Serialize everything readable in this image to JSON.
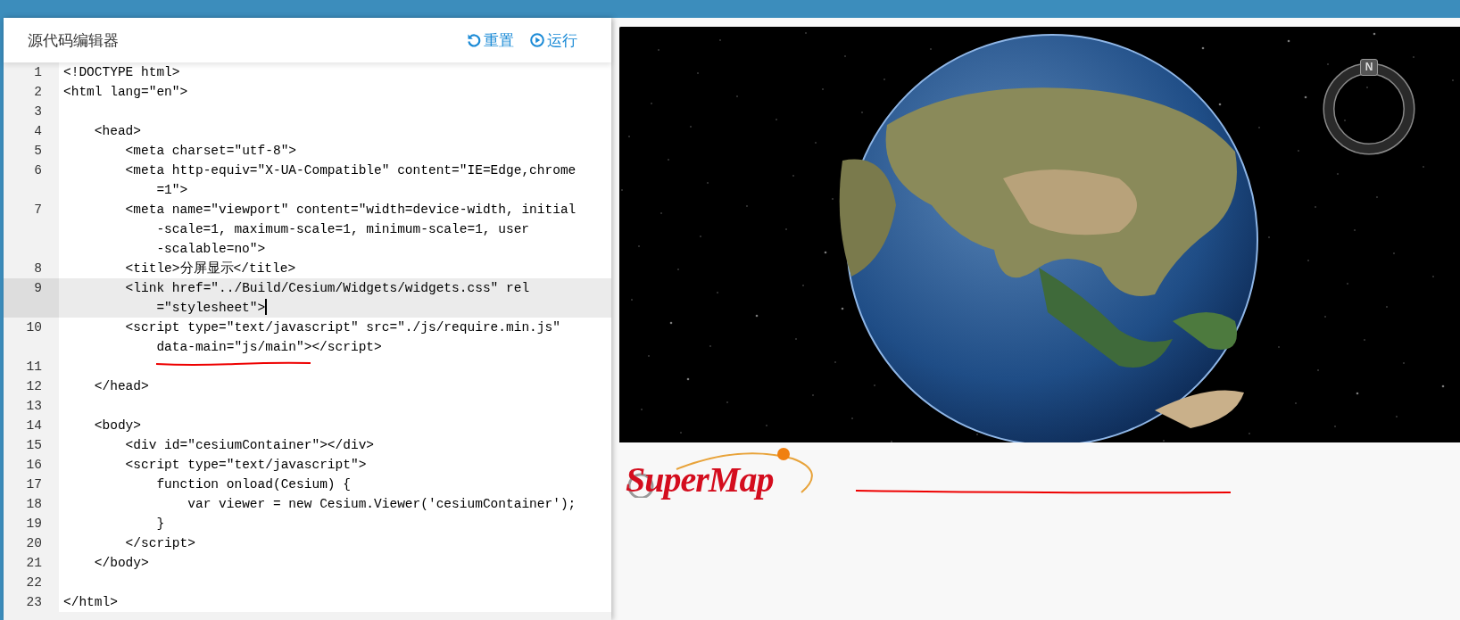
{
  "editor": {
    "title": "源代码编辑器",
    "actions": [
      {
        "kind": "reset",
        "label": "重置"
      },
      {
        "kind": "run",
        "label": "运行"
      }
    ],
    "lines": [
      {
        "number": "1",
        "selected": false,
        "parts": [
          "<!DOCTYPE html>"
        ]
      },
      {
        "number": "2",
        "selected": false,
        "parts": [
          "<html lang=\"en\">"
        ]
      },
      {
        "number": "3",
        "selected": false
      },
      {
        "number": "4",
        "selected": false,
        "parts": [
          "    <head>"
        ]
      },
      {
        "number": "5",
        "selected": false,
        "parts": [
          "        <meta charset=\"utf-8\">"
        ]
      },
      {
        "number": "6",
        "selected": false,
        "parts": [
          "        <meta http-equiv=\"X-UA-Compatible\" content=\"IE=Edge,chrome",
          "=1\">"
        ]
      },
      {
        "number": "7",
        "selected": false,
        "parts": [
          "        <meta name=\"viewport\" content=\"width=device-width, initial",
          "-scale=1, maximum-scale=1, minimum-scale=1, user",
          "-scalable=no\">"
        ]
      },
      {
        "number": "8",
        "selected": false,
        "parts": [
          "        <title>分屏显示</title>"
        ]
      },
      {
        "number": "9",
        "selected": true,
        "parts": [
          "        <link href=\"../Build/Cesium/Widgets/widgets.css\" rel",
          "=\"stylesheet\">"
        ]
      },
      {
        "number": "10",
        "selected": false,
        "parts": [
          "        <script type=\"text/javascript\" src=\"./js/require.min.js\"",
          "data-main=\"js/main\"></script>"
        ]
      },
      {
        "number": "11",
        "selected": false
      },
      {
        "number": "12",
        "selected": false,
        "parts": [
          "    </head>"
        ]
      },
      {
        "number": "13",
        "selected": false
      },
      {
        "number": "14",
        "selected": false,
        "parts": [
          "    <body>"
        ]
      },
      {
        "number": "15",
        "selected": false,
        "parts": [
          "        <div id=\"cesiumContainer\"></div>"
        ]
      },
      {
        "number": "16",
        "selected": false,
        "parts": [
          "        <script type=\"text/javascript\">"
        ]
      },
      {
        "number": "17",
        "selected": false,
        "parts": [
          "            function onload(Cesium) {"
        ]
      },
      {
        "number": "18",
        "selected": false,
        "parts": [
          "                var viewer = new Cesium.Viewer('cesiumContainer');"
        ]
      },
      {
        "number": "19",
        "selected": false,
        "parts": [
          "            }"
        ]
      },
      {
        "number": "20",
        "selected": false,
        "parts": [
          "        </script>"
        ]
      },
      {
        "number": "21",
        "selected": false,
        "parts": [
          "    </body>"
        ]
      },
      {
        "number": "22",
        "selected": false
      },
      {
        "number": "23",
        "selected": false,
        "parts": [
          "</html>"
        ]
      }
    ]
  },
  "viewer": {
    "compass": {
      "label": "N"
    }
  },
  "logo": {
    "text": "SuperMap"
  }
}
